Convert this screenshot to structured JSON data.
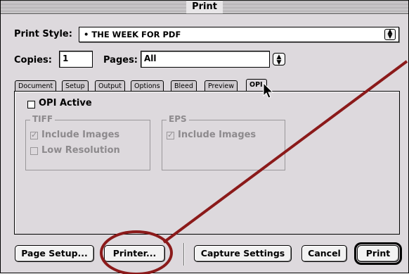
{
  "window": {
    "title": "Print"
  },
  "print_style": {
    "label": "Print Style:",
    "value": "• THE WEEK FOR PDF"
  },
  "copies": {
    "label": "Copies:",
    "value": "1"
  },
  "pages": {
    "label": "Pages:",
    "value": "All"
  },
  "tabs": [
    {
      "label": "Document"
    },
    {
      "label": "Setup"
    },
    {
      "label": "Output"
    },
    {
      "label": "Options"
    },
    {
      "label": "Bleed"
    },
    {
      "label": "Preview"
    },
    {
      "label": "OPI"
    }
  ],
  "opi": {
    "active_label": "OPI Active",
    "tiff": {
      "title": "TIFF",
      "include_images": "Include Images",
      "low_resolution": "Low Resolution"
    },
    "eps": {
      "title": "EPS",
      "include_images": "Include Images"
    }
  },
  "buttons": {
    "page_setup": "Page Setup...",
    "printer": "Printer...",
    "capture_settings": "Capture Settings",
    "cancel": "Cancel",
    "print": "Print"
  },
  "annotation_color": "#8b1a1a"
}
